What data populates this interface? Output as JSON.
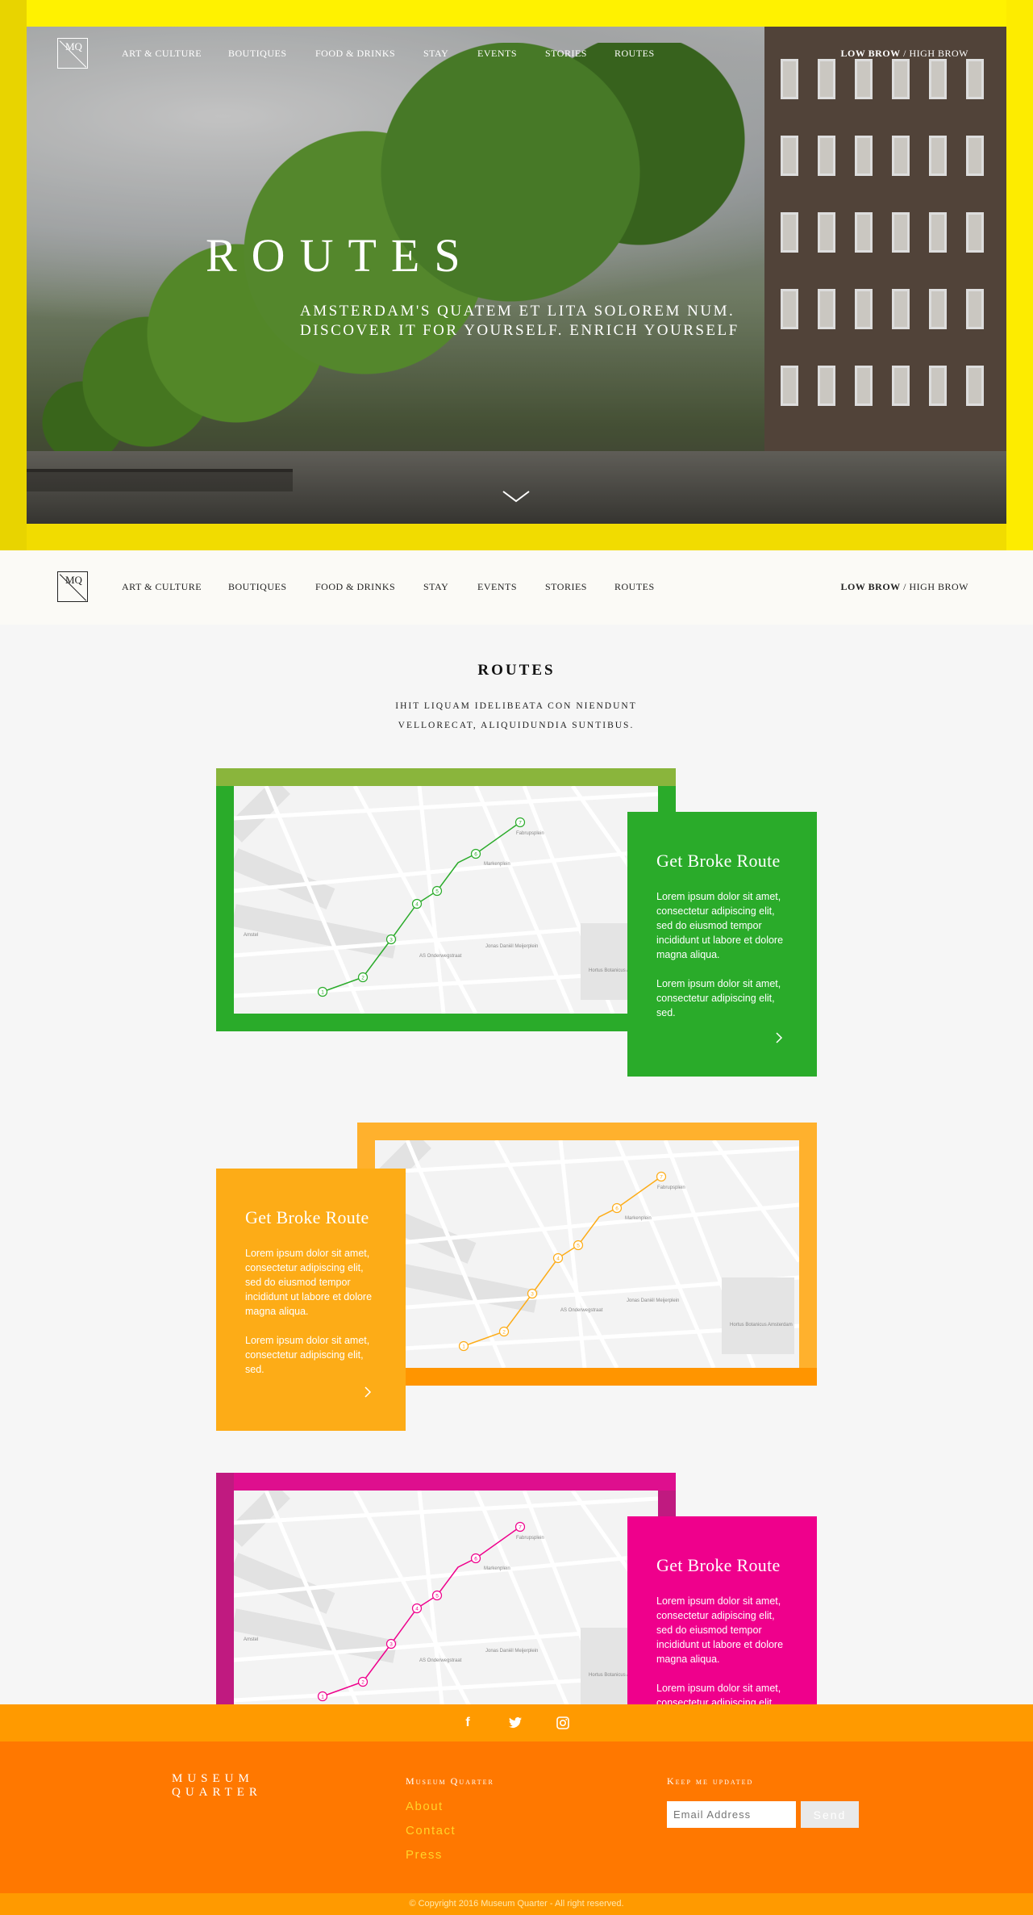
{
  "colors": {
    "hero_frame": "#f1dc00",
    "route_green": "#2aab2a",
    "route_green_frame": "#8ab53c",
    "route_orange": "#fdac17",
    "route_orange_frame": "#ffb12d",
    "route_pink": "#ef008c",
    "route_pink_frame": "#de0f8e",
    "footer": "#ff7800",
    "social_bar": "#ff9a00"
  },
  "nav": {
    "logo": "MQ",
    "items": [
      "ART & CULTURE",
      "BOUTIQUES",
      "FOOD & DRINKS",
      "STAY",
      "EVENTS",
      "STORIES",
      "ROUTES"
    ],
    "brow_low": "LOW BROW",
    "brow_sep": " / ",
    "brow_high": "HIGH BROW"
  },
  "hero": {
    "title": "ROUTES",
    "subtitle": "AMSTERDAM'S QUATEM ET LITA SOLOREM NUM. DISCOVER IT FOR YOURSELF. ENRICH YOURSELF",
    "scroll_icon": "chevron-down-icon"
  },
  "section": {
    "title": "ROUTES",
    "subtitle": "IHIT LIQUAM IDELIBEATA CON NIENDUNT VELLORECAT, ALIQUIDUNDIA SUNTIBUS."
  },
  "routes": [
    {
      "title": "Get Broke Route",
      "p1": "Lorem ipsum dolor sit amet, consectetur adipiscing elit, sed do eiusmod tempor incididunt ut labore et dolore magna aliqua.",
      "p2": "Lorem ipsum dolor sit amet, consectetur adipiscing elit, sed.",
      "color": "#2aab2a"
    },
    {
      "title": "Get Broke Route",
      "p1": "Lorem ipsum dolor sit amet, consectetur adipiscing elit, sed do eiusmod tempor incididunt ut labore et dolore magna aliqua.",
      "p2": "Lorem ipsum dolor sit amet, consectetur adipiscing elit, sed.",
      "color": "#fdac17"
    },
    {
      "title": "Get Broke Route",
      "p1": "Lorem ipsum dolor sit amet, consectetur adipiscing elit, sed do eiusmod tempor incididunt ut labore et dolore magna aliqua.",
      "p2": "Lorem ipsum dolor sit amet, consectetur adipiscing elit, sed.",
      "color": "#ef008c"
    }
  ],
  "map_labels": [
    "Amstel",
    "Markenplein",
    "Fabrupsplein",
    "AS Onderwegstraat",
    "Jonas Daniël Meijerplein",
    "Hortus Botanicus Amsterdam"
  ],
  "route_stops": [
    "1",
    "2",
    "3",
    "4",
    "5",
    "6",
    "7"
  ],
  "footer": {
    "social_icons": [
      "facebook-icon",
      "twitter-icon",
      "instagram-icon"
    ],
    "brand_line1": "MUSEUM",
    "brand_line2": "QUARTER",
    "col_title": "Museum Quarter",
    "links": [
      "About",
      "Contact",
      "Press"
    ],
    "newsletter_title": "Keep me updated",
    "email_placeholder": "Email Address",
    "send_label": "Send",
    "copyright": "© Copyright 2016 Museum Quarter - All right reserved."
  }
}
